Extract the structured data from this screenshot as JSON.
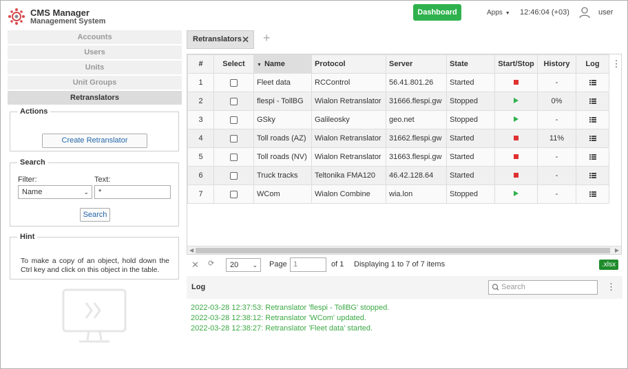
{
  "header": {
    "title": "CMS Manager",
    "subtitle": "Management System",
    "dashboard_label": "Dashboard",
    "apps_label": "Apps",
    "clock": "12:46:04 (+03)",
    "user": "user",
    "brand_color": "#2fb24d"
  },
  "nav": {
    "items": [
      {
        "label": "Accounts"
      },
      {
        "label": "Users"
      },
      {
        "label": "Units"
      },
      {
        "label": "Unit Groups"
      },
      {
        "label": "Retranslators"
      }
    ],
    "active": "Retranslators"
  },
  "actions": {
    "legend": "Actions",
    "create_label": "Create Retranslator"
  },
  "search": {
    "legend": "Search",
    "filter_label": "Filter:",
    "filter_value": "Name",
    "text_label": "Text:",
    "text_value": "*",
    "button_label": "Search"
  },
  "hint": {
    "legend": "Hint",
    "text": "To make a copy of an object, hold down the Ctrl key and click on this object in the table."
  },
  "tabs": {
    "active": "Retranslators",
    "close": "✕",
    "add": "+"
  },
  "grid": {
    "columns": [
      "#",
      "Select",
      "Name",
      "Protocol",
      "Server",
      "State",
      "Start/Stop",
      "History",
      "Log"
    ],
    "sort_column": "Name",
    "rows": [
      {
        "num": "1",
        "name": "Fleet data",
        "protocol": "RCControl",
        "server": "56.41.801.26",
        "state": "Started",
        "action": "stop",
        "history": "-"
      },
      {
        "num": "2",
        "name": "flespi - TollBG",
        "protocol": "Wialon Retranslator",
        "server": "31666.flespi.gw",
        "state": "Stopped",
        "action": "start",
        "history": "0%"
      },
      {
        "num": "3",
        "name": "GSky",
        "protocol": "Galileosky",
        "server": "geo.net",
        "state": "Stopped",
        "action": "start",
        "history": "-"
      },
      {
        "num": "4",
        "name": "Toll roads (AZ)",
        "protocol": "Wialon Retranslator",
        "server": "31662.flespi.gw",
        "state": "Started",
        "action": "stop",
        "history": "11%"
      },
      {
        "num": "5",
        "name": "Toll roads (NV)",
        "protocol": "Wialon Retranslator",
        "server": "31663.flespi.gw",
        "state": "Started",
        "action": "stop",
        "history": "-"
      },
      {
        "num": "6",
        "name": "Truck tracks",
        "protocol": "Teltonika FMA120",
        "server": "46.42.128.64",
        "state": "Started",
        "action": "stop",
        "history": "-"
      },
      {
        "num": "7",
        "name": "WCom",
        "protocol": "Wialon Combine",
        "server": "wia.lon",
        "state": "Stopped",
        "action": "start",
        "history": "-"
      }
    ]
  },
  "pager": {
    "page_size": "20",
    "page_label": "Page",
    "page_value": "1",
    "of_label": "of 1",
    "display_text": "Displaying 1 to 7 of 7 items",
    "export_label": ".xlsx"
  },
  "log": {
    "title": "Log",
    "search_placeholder": "Search",
    "lines": [
      "2022-03-28 12:37:53: Retranslator 'flespi - TollBG' stopped.",
      "2022-03-28 12:38:12: Retranslator 'WCom' updated.",
      "2022-03-28 12:38:27: Retranslator 'Fleet data' started."
    ],
    "line_color": "#3aa843"
  }
}
